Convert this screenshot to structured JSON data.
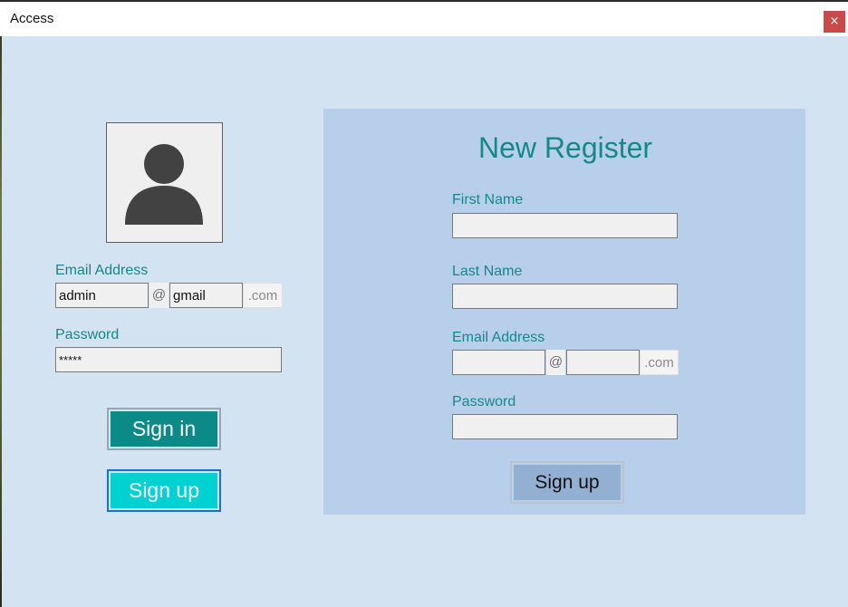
{
  "window": {
    "title": "Access",
    "close_glyph": "×"
  },
  "login": {
    "avatar_icon": "user-icon",
    "email_label": "Email Address",
    "email_user_value": "admin",
    "at_sign": "@",
    "email_domain_value": "gmail",
    "dotcom": ".com",
    "password_label": "Password",
    "password_value": "*****",
    "signin_label": "Sign in",
    "signup_label": "Sign up"
  },
  "register": {
    "title": "New Register",
    "first_name_label": "First Name",
    "first_name_value": "",
    "last_name_label": "Last Name",
    "last_name_value": "",
    "email_label": "Email Address",
    "email_user_value": "",
    "at_sign": "@",
    "email_domain_value": "",
    "dotcom": ".com",
    "password_label": "Password",
    "password_value": "",
    "signup_label": "Sign up"
  },
  "colors": {
    "background": "#D4E3F2",
    "register_panel": "#B7CFEA",
    "accent_teal": "#14888A",
    "signin_button": "#0B8A88",
    "signup_button_left": "#00D1D3",
    "signup_button_right": "#93AFD2",
    "close_button": "#C84B4B"
  }
}
